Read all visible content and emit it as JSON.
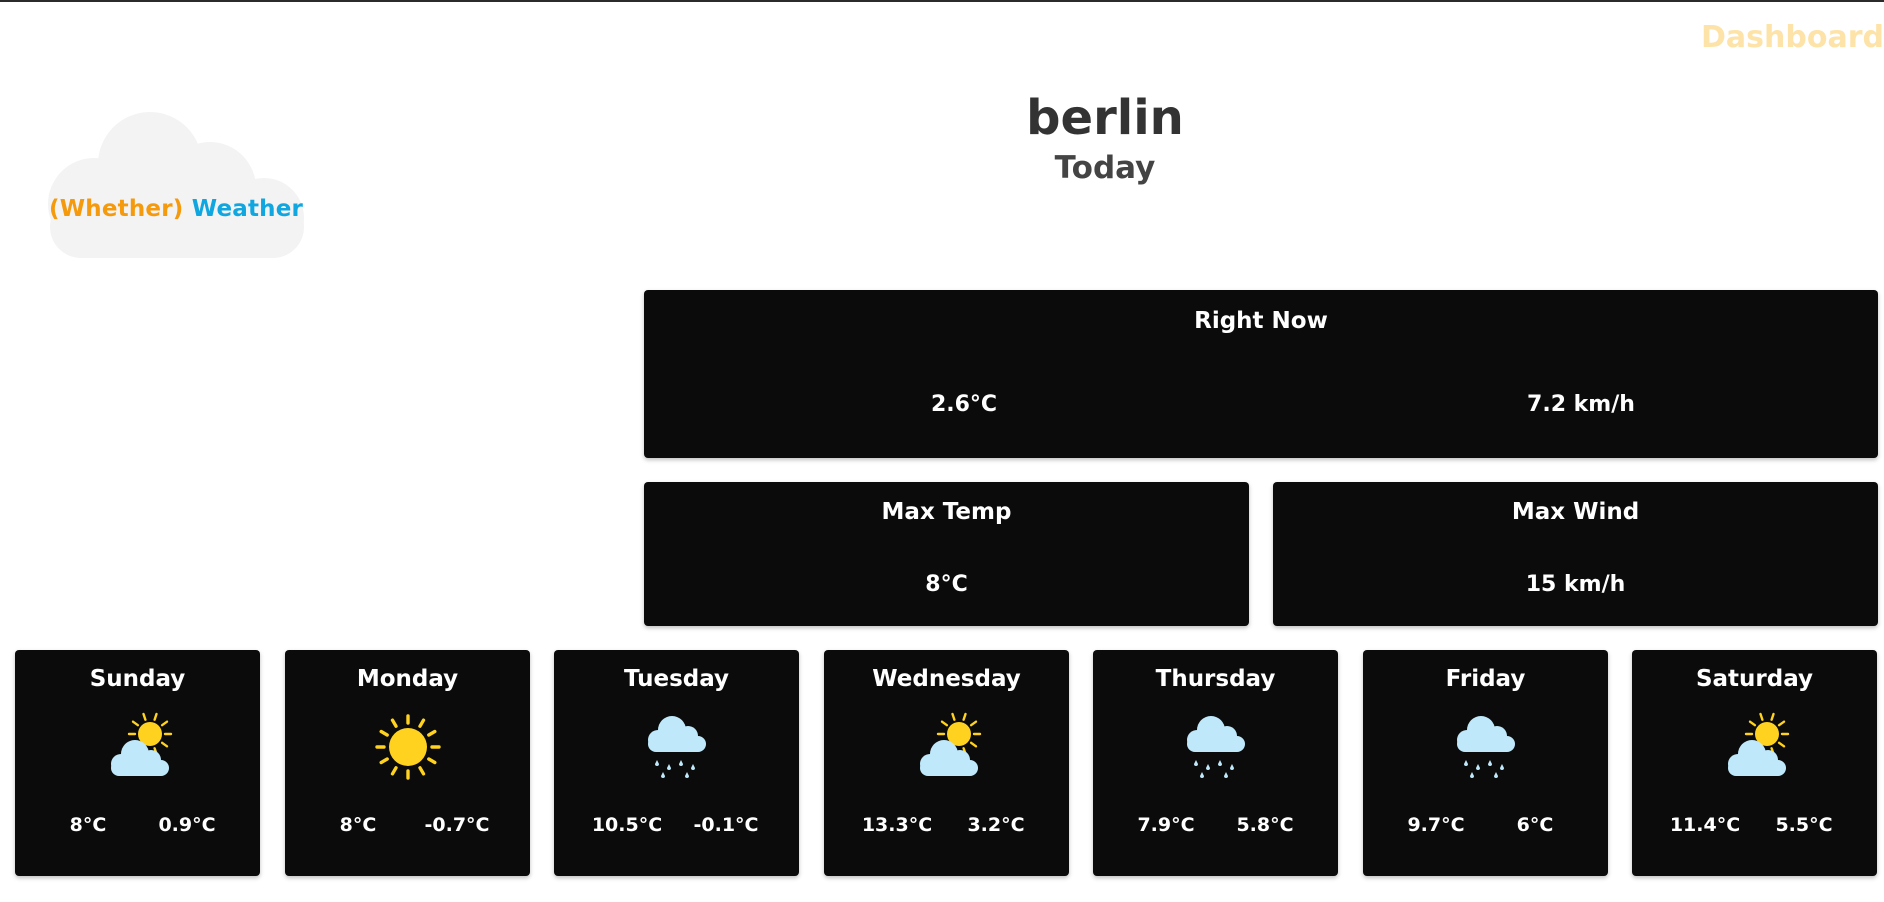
{
  "nav": {
    "dashboard_label": "Dashboard"
  },
  "logo": {
    "paren_text": "(Whether)",
    "word_text": "Weather"
  },
  "header": {
    "city": "berlin",
    "subtitle": "Today"
  },
  "right_now": {
    "title": "Right Now",
    "temperature": "2.6°C",
    "wind": "7.2 km/h"
  },
  "max_temp": {
    "title": "Max Temp",
    "value": "8°C"
  },
  "max_wind": {
    "title": "Max Wind",
    "value": "15 km/h"
  },
  "forecast": [
    {
      "day": "Sunday",
      "icon": "partly-sunny-icon",
      "high": "8°C",
      "low": "0.9°C"
    },
    {
      "day": "Monday",
      "icon": "sunny-icon",
      "high": "8°C",
      "low": "-0.7°C"
    },
    {
      "day": "Tuesday",
      "icon": "rain-cloud-icon",
      "high": "10.5°C",
      "low": "-0.1°C"
    },
    {
      "day": "Wednesday",
      "icon": "partly-sunny-icon",
      "high": "13.3°C",
      "low": "3.2°C"
    },
    {
      "day": "Thursday",
      "icon": "rain-cloud-icon",
      "high": "7.9°C",
      "low": "5.8°C"
    },
    {
      "day": "Friday",
      "icon": "rain-cloud-icon",
      "high": "9.7°C",
      "low": "6°C"
    },
    {
      "day": "Saturday",
      "icon": "partly-sunny-icon",
      "high": "11.4°C",
      "low": "5.5°C"
    }
  ],
  "colors": {
    "card_bg": "#0b0b0b",
    "nav_link": "#fde3a7",
    "logo_paren": "#f59a0c",
    "logo_word": "#10a6e0",
    "sun": "#ffd21f",
    "cloud": "#bfe9fb"
  }
}
